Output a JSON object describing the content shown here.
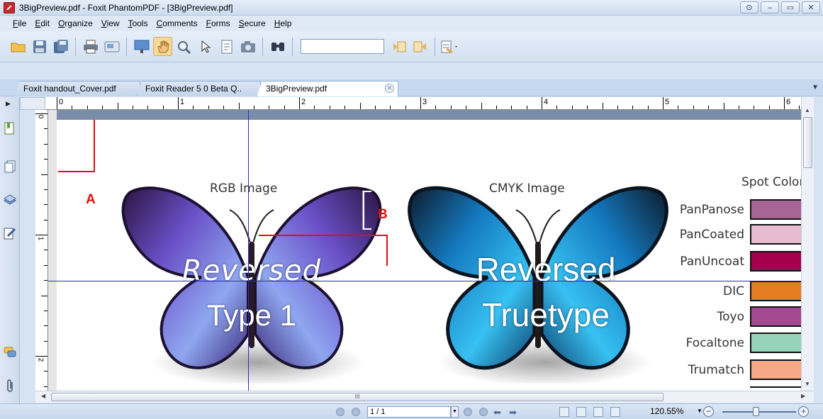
{
  "window": {
    "title": "3BigPreview.pdf - Foxit PhantomPDF - [3BigPreview.pdf]",
    "controls": [
      "⊙",
      "–",
      "▭",
      "✕"
    ]
  },
  "menu": [
    "File",
    "Edit",
    "Organize",
    "View",
    "Tools",
    "Comments",
    "Forms",
    "Secure",
    "Help"
  ],
  "toolbar": {
    "icons": [
      "open-folder-icon",
      "save-icon",
      "save-all-icon",
      "print-icon",
      "scan-icon",
      "presentation-icon",
      "hand-tool-icon",
      "loupe-icon",
      "select-cursor-icon",
      "text-select-icon",
      "snapshot-icon",
      "find-icon"
    ],
    "find_value": "",
    "accent": "#f7d99a"
  },
  "tabs": [
    {
      "label": "Foxit handout_Cover.pdf",
      "active": false
    },
    {
      "label": "Foxit Reader 5 0 Beta Q..",
      "active": false
    },
    {
      "label": "3BigPreview.pdf",
      "active": true
    }
  ],
  "ruler": {
    "h_labels": [
      "0",
      "1",
      "2",
      "3",
      "4",
      "5",
      "6"
    ],
    "v_labels": [
      "0",
      "1",
      "2"
    ]
  },
  "document": {
    "rgb_label": "RGB Image",
    "cmyk_label": "CMYK Image",
    "rgb_text_line1": "Reversed",
    "rgb_text_line2": "Type 1",
    "cmyk_text_line1": "Reversed",
    "cmyk_text_line2": "Truetype",
    "spot_title": "Spot Color",
    "spot_colors": [
      {
        "name": "PanPanose",
        "color": "#a96496"
      },
      {
        "name": "PanCoated",
        "color": "#e7bcd1"
      },
      {
        "name": "PanUncoat",
        "color": "#a4004f"
      },
      {
        "name": "DIC",
        "color": "#e47e22"
      },
      {
        "name": "Toyo",
        "color": "#a24991"
      },
      {
        "name": "Focaltone",
        "color": "#97d3bb"
      },
      {
        "name": "Trumatch",
        "color": "#f6a889"
      }
    ],
    "annotations": [
      "A",
      "B"
    ]
  },
  "hscroll_grip": "III",
  "status": {
    "page": "1 / 1",
    "zoom": "120.55%",
    "zoom_minus": "−",
    "zoom_plus": "+",
    "zoom_level": 0.45
  }
}
